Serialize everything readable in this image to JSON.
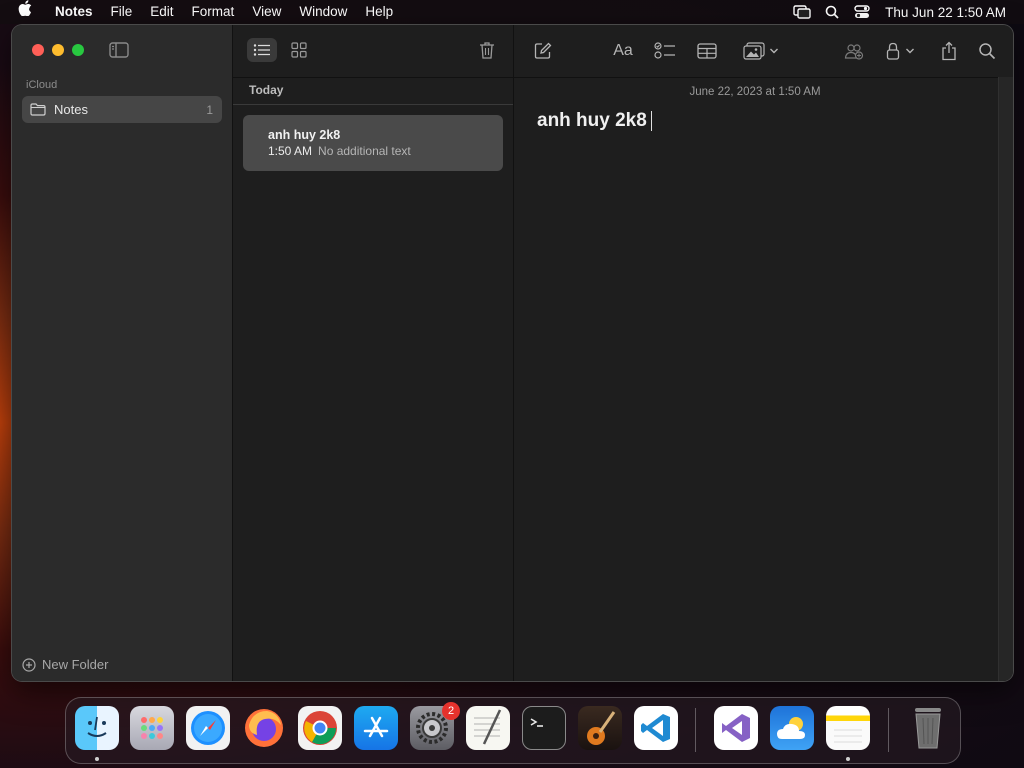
{
  "menubar": {
    "app": "Notes",
    "items": [
      "File",
      "Edit",
      "Format",
      "View",
      "Window",
      "Help"
    ],
    "clock": "Thu Jun 22  1:50 AM"
  },
  "sidebar": {
    "section": "iCloud",
    "folders": [
      {
        "label": "Notes",
        "count": "1"
      }
    ],
    "new_folder": "New Folder"
  },
  "note_list": {
    "group": "Today",
    "notes": [
      {
        "title": "anh huy 2k8",
        "time": "1:50 AM",
        "preview": "No additional text"
      }
    ]
  },
  "editor": {
    "date": "June 22, 2023 at 1:50 AM",
    "body": "anh huy 2k8",
    "format_label": "Aa"
  },
  "dock": {
    "apps": [
      "finder",
      "launchpad",
      "safari",
      "firefox",
      "chrome",
      "app-store",
      "system-settings",
      "textedit",
      "terminal",
      "garageband",
      "vscode",
      "visual-studio",
      "weather",
      "notes",
      "trash"
    ],
    "system_settings_badge": "2"
  },
  "colors": {
    "red": "#ff5f57",
    "yellow": "#febc2e",
    "green": "#28c840",
    "selection": "#4a4a4a"
  }
}
